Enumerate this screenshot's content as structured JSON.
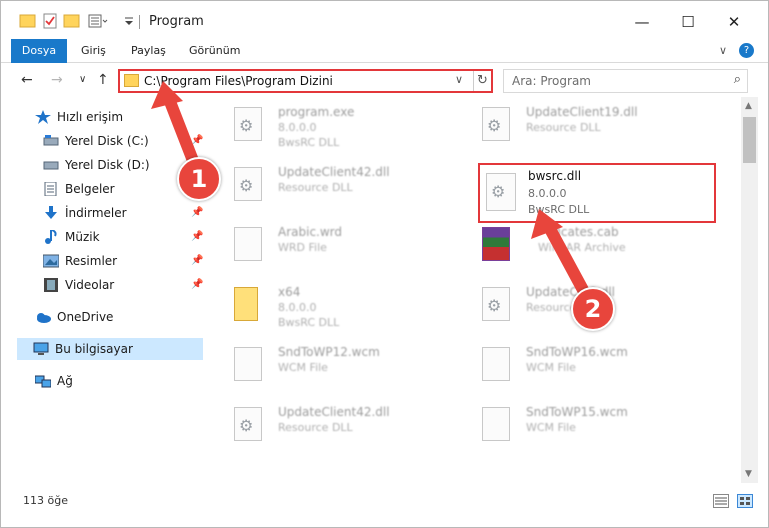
{
  "window": {
    "title": "Program",
    "minimize": "—",
    "maximize": "☐",
    "close": "✕"
  },
  "ribbon": {
    "tabs": [
      "Dosya",
      "Giriş",
      "Paylaş",
      "Görünüm"
    ],
    "expand": "∨",
    "help": "?"
  },
  "address": {
    "path": "C:\\Program Files\\Program Dizini",
    "dropdown": "∨",
    "refresh": "↻"
  },
  "search": {
    "placeholder": "Ara: Program",
    "icon": "⌕"
  },
  "nav": {
    "back": "←",
    "forward": "→",
    "recent": "∨",
    "up": "↑"
  },
  "sidebar": {
    "items": [
      {
        "label": "Hızlı erişim",
        "icon": "star-icon"
      },
      {
        "label": "Yerel Disk (C:)",
        "icon": "drive-icon"
      },
      {
        "label": "Yerel Disk (D:)",
        "icon": "drive-icon"
      },
      {
        "label": "Belgeler",
        "icon": "documents-icon"
      },
      {
        "label": "İndirmeler",
        "icon": "download-icon"
      },
      {
        "label": "Müzik",
        "icon": "music-icon"
      },
      {
        "label": "Resimler",
        "icon": "pictures-icon"
      },
      {
        "label": "Videolar",
        "icon": "videos-icon"
      },
      {
        "label": "OneDrive",
        "icon": "cloud-icon"
      },
      {
        "label": "Bu bilgisayar",
        "icon": "computer-icon"
      },
      {
        "label": "Ağ",
        "icon": "network-icon"
      }
    ]
  },
  "files": [
    {
      "name": "program.exe",
      "line1": "8.0.0.0",
      "line2": "BwsRC DLL"
    },
    {
      "name": "UpdateClient19.dll",
      "line1": "Resource DLL",
      "line2": ""
    },
    {
      "name": "UpdateClient42.dll",
      "line1": "Resource DLL",
      "line2": ""
    },
    {
      "name": "bwsrc.dll",
      "line1": "8.0.0.0",
      "line2": "BwsRC DLL"
    },
    {
      "name": "Arabic.wrd",
      "line1": "WRD File",
      "line2": ""
    },
    {
      "name": "ificates.cab",
      "line1": "WinRAR Archive",
      "line2": ""
    },
    {
      "name": "x64",
      "line1": "8.0.0.0",
      "line2": "BwsRC DLL"
    },
    {
      "name": "UpdateC...0.dll",
      "line1": "Resource",
      "line2": ""
    },
    {
      "name": "SndToWP12.wcm",
      "line1": "WCM File",
      "line2": ""
    },
    {
      "name": "SndToWP16.wcm",
      "line1": "WCM File",
      "line2": ""
    },
    {
      "name": "UpdateClient42.dll",
      "line1": "Resource DLL",
      "line2": ""
    },
    {
      "name": "SndToWP15.wcm",
      "line1": "WCM File",
      "line2": ""
    }
  ],
  "status": {
    "count": "113 öğe"
  },
  "annotations": {
    "badge1": "1",
    "badge2": "2",
    "arrow_color": "#e8453c"
  }
}
